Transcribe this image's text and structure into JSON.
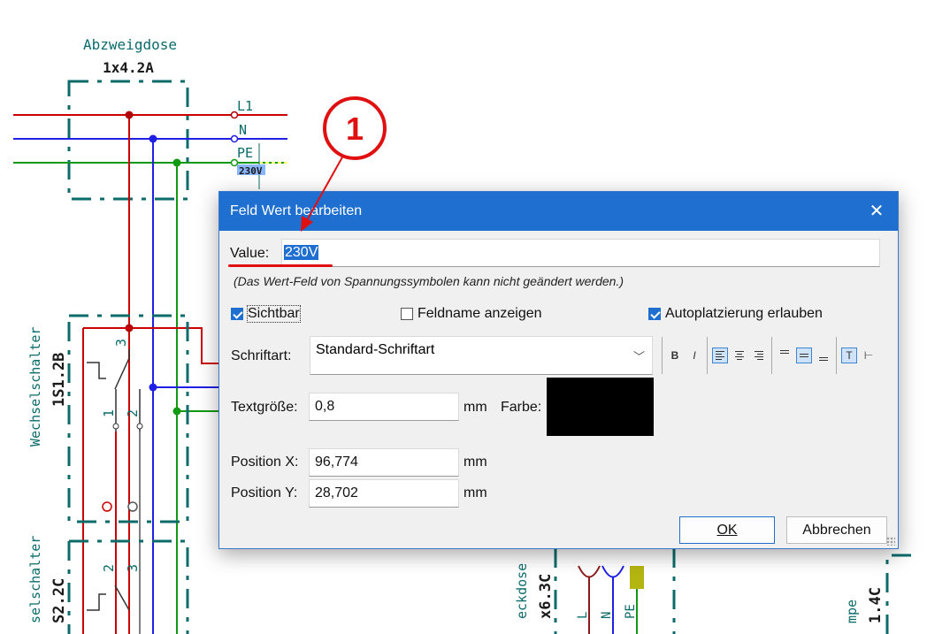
{
  "schematic": {
    "box_title": "Abzweigdose",
    "box_ref": "1x4.2A",
    "wire_labels": [
      "L1",
      "N",
      "PE"
    ],
    "voltage_label": "230V",
    "switch1_name": "Wechselschalter",
    "switch1_ref": "1S1.2B",
    "switch2_name": "selschalter",
    "switch2_ref": "S2.2C",
    "socket_name": "eckdose",
    "socket_ref": "x6.3C",
    "socket_pins": [
      "L",
      "N",
      "PE"
    ],
    "lamp_name": "mpe",
    "lamp_ref": "1.4C",
    "switch_pins": [
      "3",
      "1",
      "2",
      "2",
      "3"
    ],
    "callout_number": "1",
    "colors": {
      "l1": "#cc0000",
      "n": "#1f1fe6",
      "pe": "#119911",
      "teal": "#0b6b6b",
      "annotation": "#e01010"
    }
  },
  "dialog": {
    "title": "Feld Wert bearbeiten",
    "close_icon": "close-icon",
    "value_label": "Value:",
    "value": "230V",
    "note": "(Das Wert-Feld von Spannungssymbolen kann nicht geändert werden.)",
    "checkboxes": {
      "visible": {
        "label": "Sichtbar",
        "checked": true
      },
      "show_name": {
        "label": "Feldname anzeigen",
        "checked": false
      },
      "autoplace": {
        "label": "Autoplatzierung erlauben",
        "checked": true
      }
    },
    "font_label": "Schriftart:",
    "font_value": "Standard-Schriftart",
    "toolbar": {
      "bold": "B",
      "italic": "I",
      "top_align": "T",
      "icons": [
        "bold-icon",
        "italic-icon",
        "align-left-icon",
        "align-center-icon",
        "align-right-icon",
        "valign-top-icon",
        "valign-center-icon",
        "valign-bottom-icon",
        "text-top-icon",
        "text-bottom-icon"
      ]
    },
    "text_size_label": "Textgröße:",
    "text_size": "0,8",
    "unit": "mm",
    "color_label": "Farbe:",
    "color_value": "#000000",
    "pos_x_label": "Position X:",
    "pos_x": "96,774",
    "pos_y_label": "Position Y:",
    "pos_y": "28,702",
    "ok": "OK",
    "cancel": "Abbrechen"
  }
}
